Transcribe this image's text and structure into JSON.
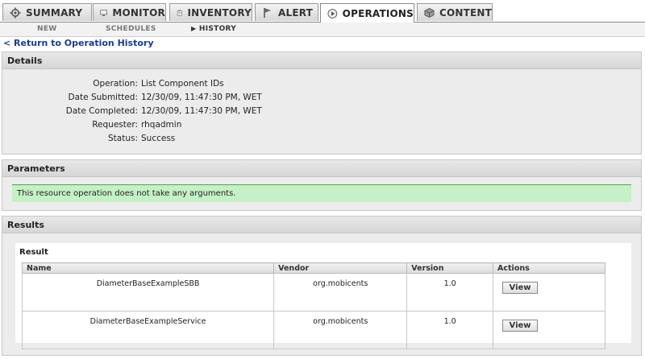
{
  "tabs": [
    {
      "label": "SUMMARY",
      "icon": "gear-icon"
    },
    {
      "label": "MONITOR",
      "icon": "monitor-icon"
    },
    {
      "label": "INVENTORY",
      "icon": "clipboard-icon"
    },
    {
      "label": "ALERT",
      "icon": "flag-icon"
    },
    {
      "label": "OPERATIONS",
      "icon": "play-icon",
      "active": true
    },
    {
      "label": "CONTENT",
      "icon": "package-icon"
    }
  ],
  "subtabs": [
    {
      "label": "NEW"
    },
    {
      "label": "SCHEDULES"
    },
    {
      "label": "HISTORY",
      "active": true
    }
  ],
  "back_link": "< Return to Operation History",
  "details": {
    "title": "Details",
    "rows": [
      {
        "label": "Operation:",
        "value": "List Component IDs"
      },
      {
        "label": "Date Submitted:",
        "value": "12/30/09, 11:47:30 PM, WET"
      },
      {
        "label": "Date Completed:",
        "value": "12/30/09, 11:47:30 PM, WET"
      },
      {
        "label": "Requester:",
        "value": "rhqadmin"
      },
      {
        "label": "Status:",
        "value": "Success"
      }
    ]
  },
  "parameters": {
    "title": "Parameters",
    "message": "This resource operation does not take any arguments."
  },
  "results": {
    "title": "Results",
    "subtitle": "Result",
    "columns": [
      "Name",
      "Vendor",
      "Version",
      "Actions"
    ],
    "rows": [
      {
        "name": "DiameterBaseExampleSBB",
        "vendor": "org.mobicents",
        "version": "1.0",
        "action": "View"
      },
      {
        "name": "DiameterBaseExampleService",
        "vendor": "org.mobicents",
        "version": "1.0",
        "action": "View"
      }
    ]
  },
  "colors": {
    "link": "#1a3d8f",
    "success_bg": "#c6f0c6"
  }
}
